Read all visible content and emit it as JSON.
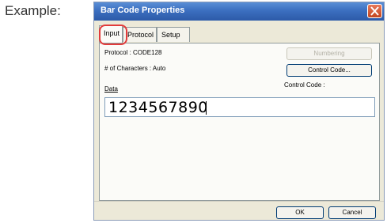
{
  "example_label": "Example:",
  "window": {
    "title": "Bar Code Properties",
    "tabs": [
      {
        "label": "Input",
        "active": true
      },
      {
        "label": "Protocol",
        "active": false
      },
      {
        "label": "Setup",
        "active": false
      }
    ],
    "protocol_line": "Protocol : CODE128",
    "chars_line": "# of Characters : Auto",
    "data_label": "Data",
    "data_value": "1234567890",
    "numbering_button": "Numbering",
    "control_code_button": "Control Code...",
    "control_code_label": "Control Code :",
    "ok_button": "OK",
    "cancel_button": "Cancel"
  },
  "colors": {
    "titlebar": "#3c6fc0",
    "highlight": "#e23b3b",
    "dialog_bg": "#ece9d8"
  }
}
